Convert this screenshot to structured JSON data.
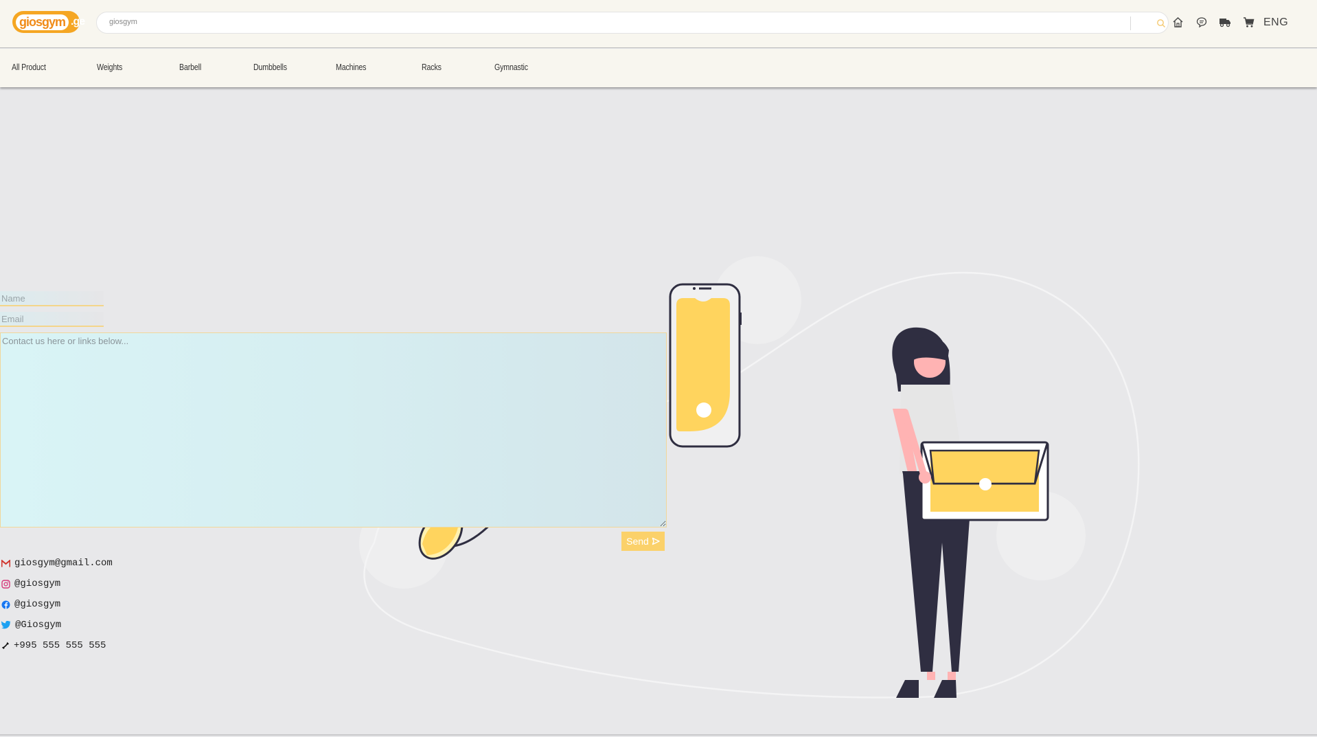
{
  "header": {
    "logo": {
      "main": "giosgym",
      "tld": ".ge"
    },
    "search": {
      "placeholder": "giosgym"
    },
    "icons": [
      "search-icon",
      "home-icon",
      "chat-icon",
      "truck-icon",
      "cart-icon"
    ],
    "language": "ENG"
  },
  "nav": {
    "items": [
      {
        "label": "All Product"
      },
      {
        "label": "Weights"
      },
      {
        "label": "Barbell"
      },
      {
        "label": "Dumbbells"
      },
      {
        "label": "Machines"
      },
      {
        "label": "Racks"
      },
      {
        "label": "Gymnastic"
      }
    ]
  },
  "form": {
    "name_placeholder": "Name",
    "email_placeholder": "Email",
    "message_placeholder": "Contact us here or links below...",
    "send_label": "Send"
  },
  "contacts": [
    {
      "icon": "gmail-icon",
      "text": "giosgym@gmail.com"
    },
    {
      "icon": "instagram-icon",
      "text": "@giosgym"
    },
    {
      "icon": "facebook-icon",
      "text": "@giosgym"
    },
    {
      "icon": "twitter-icon",
      "text": "@Giosgym"
    },
    {
      "icon": "phone-icon",
      "text": "+995 555 555 555"
    }
  ],
  "colors": {
    "accent": "#f5a623",
    "send_button": "#fbd16a",
    "illustration_yellow": "#ffd45e",
    "illustration_dark": "#2f2e41",
    "header_bg": "#f8f6ef",
    "page_bg": "#e8e8ea"
  }
}
